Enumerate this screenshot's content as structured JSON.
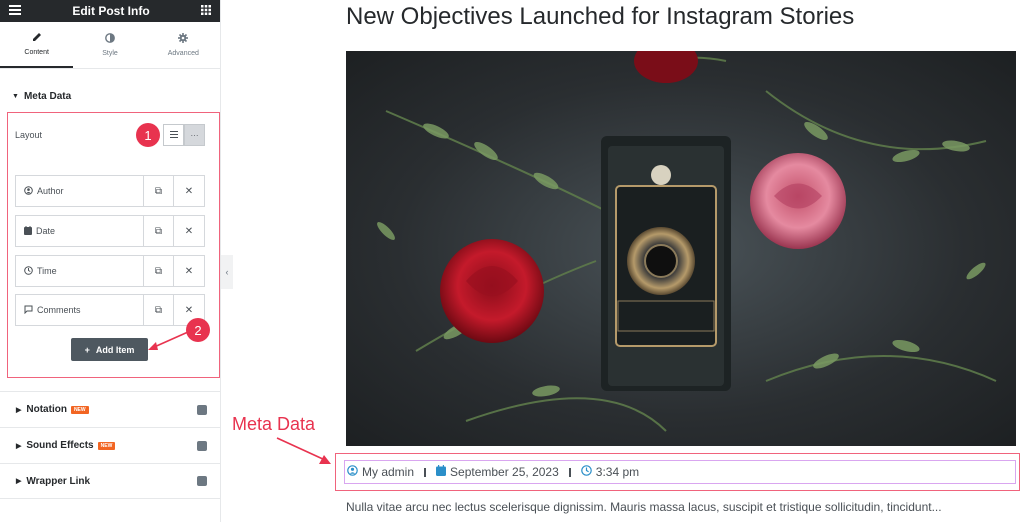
{
  "panel": {
    "title": "Edit Post Info",
    "tabs": [
      {
        "label": "Content",
        "icon": "pencil-icon",
        "active": true
      },
      {
        "label": "Style",
        "icon": "contrast-icon",
        "active": false
      },
      {
        "label": "Advanced",
        "icon": "gear-icon",
        "active": false
      }
    ],
    "meta_section": {
      "label": "Meta Data",
      "layout_label": "Layout",
      "items": [
        {
          "label": "Author",
          "icon": "user-circle-icon"
        },
        {
          "label": "Date",
          "icon": "calendar-icon"
        },
        {
          "label": "Time",
          "icon": "clock-icon"
        },
        {
          "label": "Comments",
          "icon": "comment-icon"
        }
      ],
      "add_item_label": "Add Item"
    },
    "accordions": [
      {
        "label": "Notation",
        "new_badge": "NEW"
      },
      {
        "label": "Sound Effects",
        "new_badge": "NEW"
      },
      {
        "label": "Wrapper Link",
        "new_badge": ""
      }
    ]
  },
  "annotations": {
    "badge1": "1",
    "badge2": "2",
    "meta_label": "Meta Data",
    "accent_color": "#e8334f"
  },
  "post": {
    "title": "New Objectives Launched for Instagram Stories",
    "author": "My admin",
    "date": "September 25, 2023",
    "time": "3:34 pm",
    "excerpt": "Nulla vitae arcu nec lectus scelerisque dignissim. Mauris massa lacus, suscipit et tristique sollicitudin, tincidunt..."
  }
}
